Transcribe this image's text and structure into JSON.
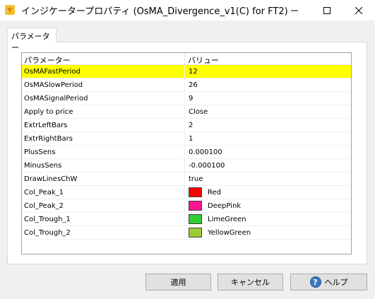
{
  "window": {
    "title": "インジケータープロパティ (OsMA_Divergence_v1(C) for FT2)"
  },
  "tabs": [
    {
      "label": "パラメーター"
    }
  ],
  "grid": {
    "header": {
      "name": "パラメーター",
      "value": "バリュー"
    },
    "rows": [
      {
        "name": "OsMAFastPeriod",
        "value": "12",
        "selected": true
      },
      {
        "name": "OsMASlowPeriod",
        "value": "26"
      },
      {
        "name": "OsMASignalPeriod",
        "value": "9"
      },
      {
        "name": "Apply to price",
        "value": "Close"
      },
      {
        "name": "ExtrLeftBars",
        "value": "2"
      },
      {
        "name": "ExtrRightBars",
        "value": "1"
      },
      {
        "name": "PlusSens",
        "value": "0.000100"
      },
      {
        "name": "MinusSens",
        "value": "-0.000100"
      },
      {
        "name": "DrawLinesChW",
        "value": "true"
      },
      {
        "name": "Col_Peak_1",
        "value": "Red",
        "color": "#ff0000"
      },
      {
        "name": "Col_Peak_2",
        "value": "DeepPink",
        "color": "#ff1493"
      },
      {
        "name": "Col_Trough_1",
        "value": "LimeGreen",
        "color": "#32cd32"
      },
      {
        "name": "Col_Trough_2",
        "value": "YellowGreen",
        "color": "#9acd32"
      }
    ]
  },
  "buttons": {
    "apply": "適用",
    "cancel": "キャンセル",
    "help": "ヘルプ"
  },
  "colors": {
    "selection": "#ffff00",
    "help_icon": "#3b78c4"
  },
  "icons": {
    "app": "indicator-app-icon",
    "minimize": "minimize-icon",
    "maximize": "maximize-icon",
    "close": "close-icon",
    "help": "help-icon"
  }
}
